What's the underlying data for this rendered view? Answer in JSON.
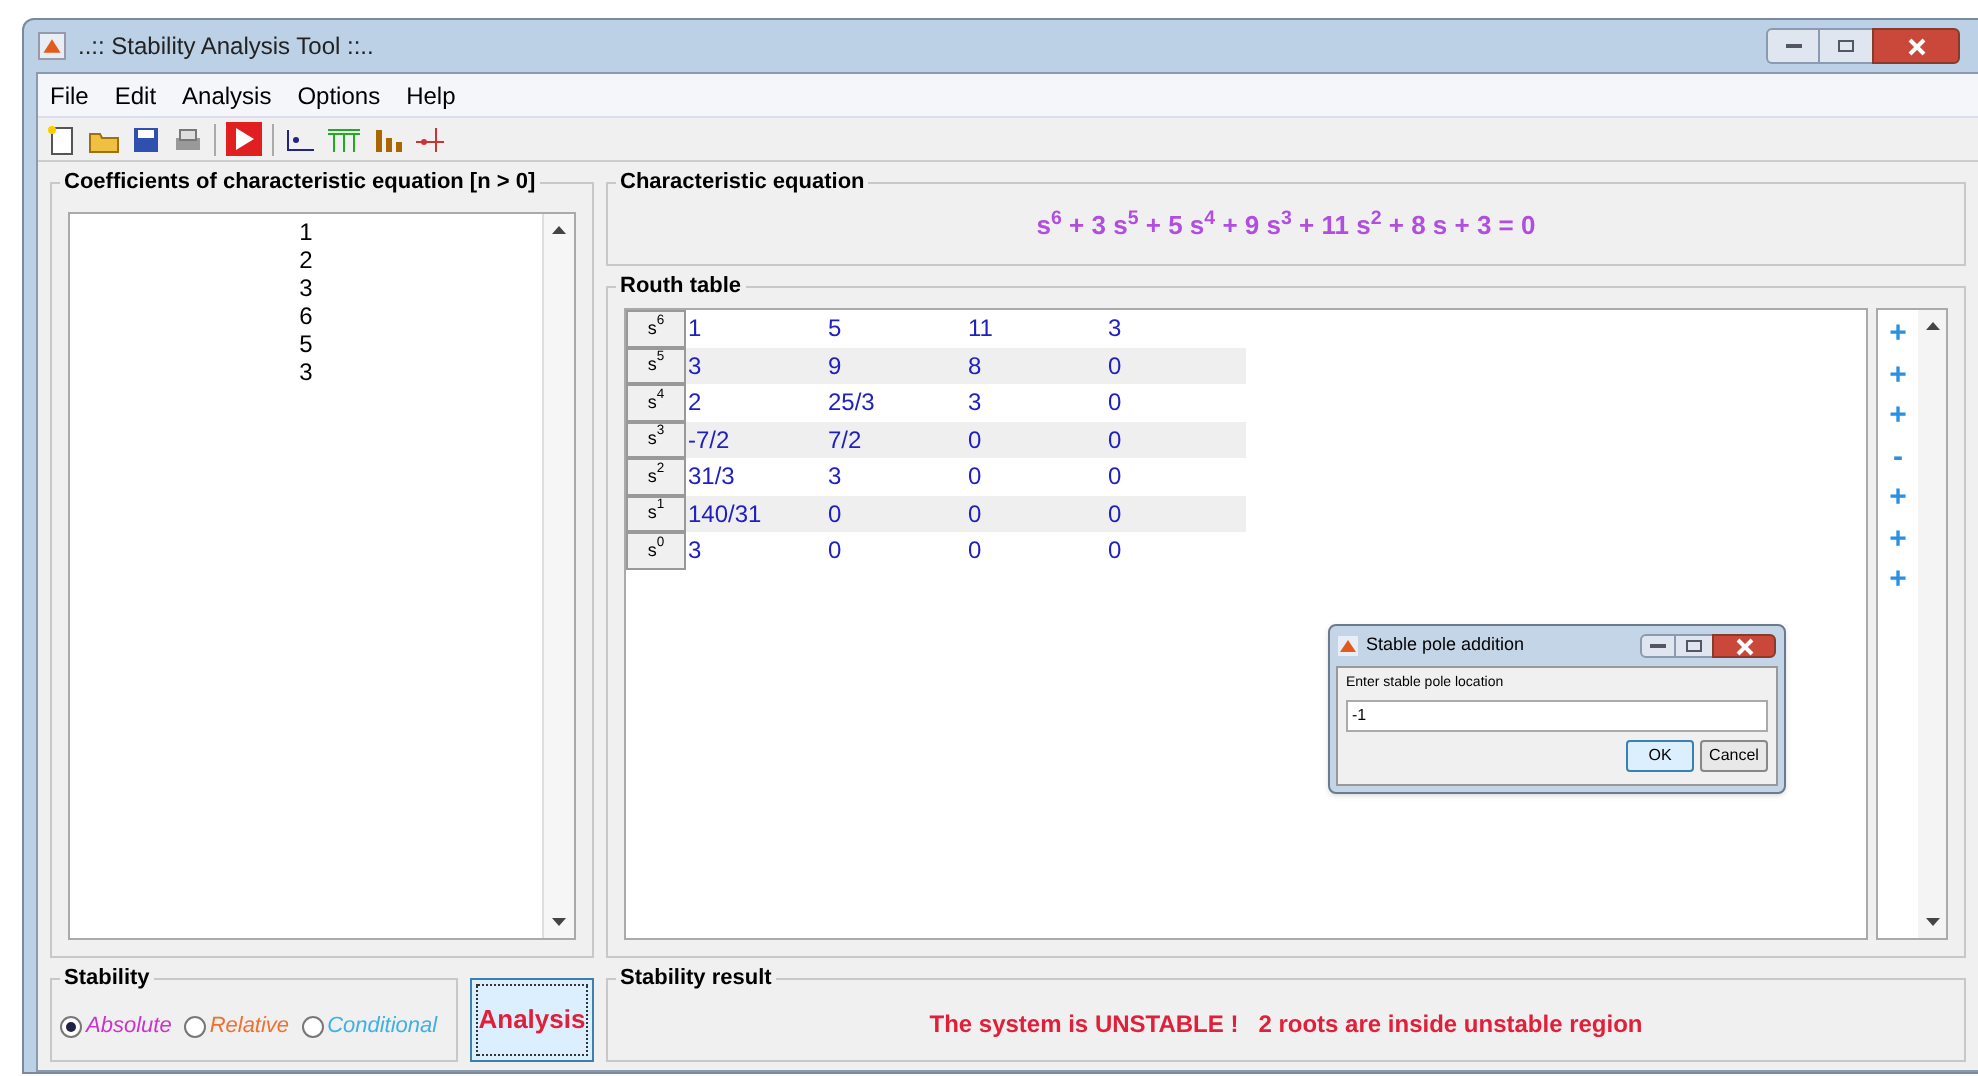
{
  "window": {
    "title": "..:: Stability Analysis Tool ::.."
  },
  "menu": [
    "File",
    "Edit",
    "Analysis",
    "Options",
    "Help"
  ],
  "coefficients": {
    "title": "Coefficients of characteristic equation [n > 0]",
    "values": [
      "1",
      "2",
      "3",
      "6",
      "5",
      "3"
    ]
  },
  "equation": {
    "title": "Characteristic equation",
    "text": "s$^{6}$ + 3 s$^{5}$ + 5 s$^{4}$ + 9 s$^{3}$ + 11 s$^{2}$ + 8 s + 3 = 0"
  },
  "routh": {
    "title": "Routh table",
    "rows": [
      {
        "label": "s$^{6}$",
        "cells": [
          "1",
          "5",
          "11",
          "3"
        ]
      },
      {
        "label": "s$^{5}$",
        "cells": [
          "3",
          "9",
          "8",
          "0"
        ]
      },
      {
        "label": "s$^{4}$",
        "cells": [
          "2",
          "25/3",
          "3",
          "0"
        ]
      },
      {
        "label": "s$^{3}$",
        "cells": [
          "-7/2",
          "7/2",
          "0",
          "0"
        ]
      },
      {
        "label": "s$^{2}$",
        "cells": [
          "31/3",
          "3",
          "0",
          "0"
        ]
      },
      {
        "label": "s$^{1}$",
        "cells": [
          "140/31",
          "0",
          "0",
          "0"
        ]
      },
      {
        "label": "s$^{0}$",
        "cells": [
          "3",
          "0",
          "0",
          "0"
        ]
      }
    ],
    "signs": [
      "+",
      "+",
      "+",
      "-",
      "+",
      "+",
      "+"
    ]
  },
  "stability": {
    "title": "Stability",
    "options": [
      {
        "label": "Absolute",
        "selected": true,
        "color": "#cc33cc"
      },
      {
        "label": "Relative",
        "selected": false,
        "color": "#f07030"
      },
      {
        "label": "Conditional",
        "selected": false,
        "color": "#40b0e0"
      }
    ]
  },
  "analysis_button": "Analysis",
  "result": {
    "title": "Stability result",
    "text": "The system is UNSTABLE !   2 roots are inside unstable region"
  },
  "dialog": {
    "title": "Stable pole addition",
    "prompt": "Enter stable pole location",
    "value": "-1",
    "buttons": [
      "OK",
      "Cancel"
    ]
  }
}
